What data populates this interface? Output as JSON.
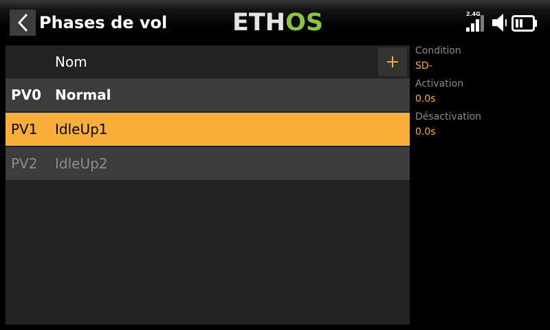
{
  "header": {
    "title": "Phases de vol",
    "logo_left": "ETH",
    "logo_right": "OS",
    "signal_label": "2.4G",
    "back_icon": "chevron-left-icon",
    "signal_icon": "signal-bars-icon",
    "speaker_icon": "speaker-icon",
    "battery_icon": "battery-icon"
  },
  "list": {
    "column_name": "Nom",
    "add_icon": "plus-icon",
    "rows": [
      {
        "code": "PV0",
        "name": "Normal",
        "state": "normal"
      },
      {
        "code": "PV1",
        "name": "IdleUp1",
        "state": "selected"
      },
      {
        "code": "PV2",
        "name": "IdleUp2",
        "state": "disabled"
      }
    ]
  },
  "info": {
    "condition_label": "Condition",
    "condition_value": "SD-",
    "activation_label": "Activation",
    "activation_value": "0.0s",
    "deactivation_label": "Désactivation",
    "deactivation_value": "0.0s"
  },
  "colors": {
    "accent": "#f8ae38",
    "logo_green": "#8bc43f",
    "row_bg": "#3c3c3c",
    "panel_bg": "#222222"
  }
}
